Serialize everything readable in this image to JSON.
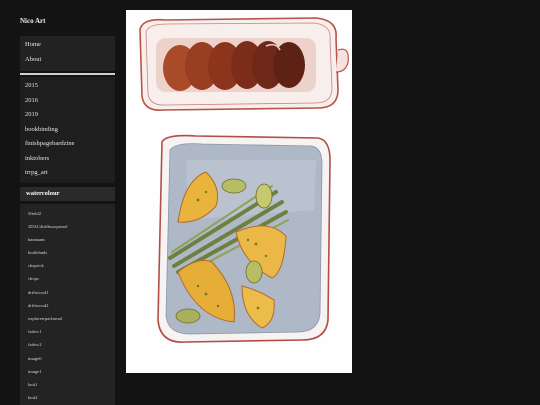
{
  "site": {
    "title": "Nico Art"
  },
  "nav": {
    "items": [
      "Home",
      "About"
    ]
  },
  "categories": [
    "2015",
    "2016",
    "2019",
    "bookbinding",
    "finishpagebardzine",
    "inktobers",
    "trrpg_art"
  ],
  "active_category": "watercolour",
  "subcategories": [
    "5field2",
    "3DAC4ttrlhsoopsmol",
    "bananans",
    "bottlebnds",
    "chaprick",
    "chops",
    "driftwood1",
    "driftwood2",
    "explorerrpachsmol",
    "fadwc1",
    "fadwc2",
    "image0",
    "image1",
    "knit1",
    "knit2",
    "pantrypotsmol"
  ],
  "artwork": {
    "description_icon": "watercolour-painting-image",
    "colors": {
      "plum": "#6b2a1c",
      "tray_blue": "#a9b4c4",
      "lemon": "#e7b23a",
      "asparagus": "#7b8c4c"
    }
  }
}
